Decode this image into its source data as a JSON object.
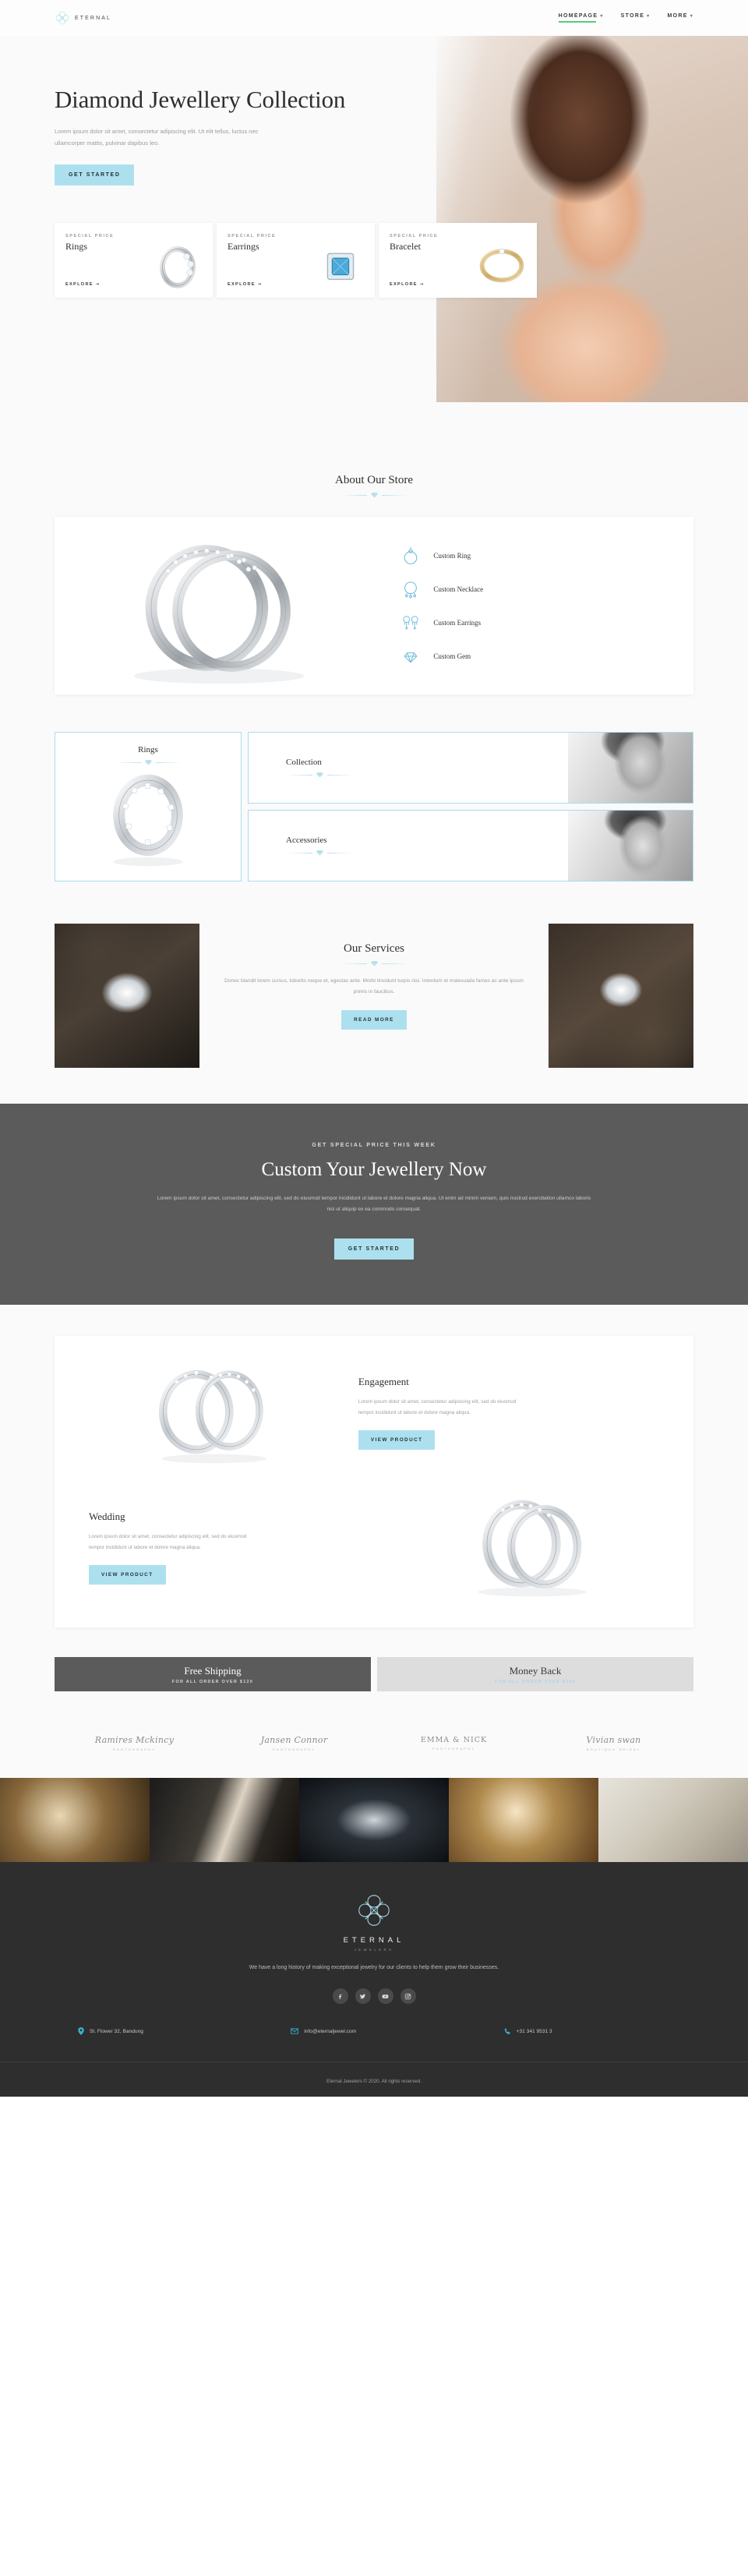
{
  "nav": {
    "brand": "ETERNAL",
    "items": [
      {
        "label": "HOMEPAGE",
        "caret": "▾",
        "active": true
      },
      {
        "label": "STORE",
        "caret": "▾",
        "active": false
      },
      {
        "label": "MORE",
        "caret": "▾",
        "active": false
      }
    ]
  },
  "hero": {
    "title": "Diamond Jewellery Collection",
    "text": "Lorem ipsum dolor sit amet, consectetur adipiscing elit. Ut elit tellus, luctus nec ullamcorper mattis, pulvinar dapibus leo.",
    "cta": "GET STARTED",
    "cards": [
      {
        "label": "SPECIAL PRICE",
        "title": "Rings",
        "link": "EXPLORE ➝",
        "icon": "ring-icon"
      },
      {
        "label": "SPECIAL PRICE",
        "title": "Earrings",
        "link": "EXPLORE ➝",
        "icon": "earring-icon"
      },
      {
        "label": "SPECIAL PRICE",
        "title": "Bracelet",
        "link": "EXPLORE ➝",
        "icon": "bracelet-icon"
      }
    ]
  },
  "about": {
    "title": "About Our Store",
    "features": [
      {
        "label": "Custom Ring",
        "icon": "custom-ring-icon"
      },
      {
        "label": "Custom Necklace",
        "icon": "custom-necklace-icon"
      },
      {
        "label": "Custom Earrings",
        "icon": "custom-earrings-icon"
      },
      {
        "label": "Custom Gem",
        "icon": "custom-gem-icon"
      }
    ]
  },
  "categories": {
    "left": {
      "name": "Rings"
    },
    "rows": [
      {
        "name": "Collection"
      },
      {
        "name": "Accessories"
      }
    ]
  },
  "services": {
    "title": "Our Services",
    "text": "Donec blandit lorem cursus, lobortis neque et, egestas ante. Morbi tincidunt turpis nisi. Interdum et malesuada fames ac ante ipsum primis in faucibus.",
    "cta": "READ MORE"
  },
  "cta": {
    "kicker": "GET SPECIAL PRICE THIS WEEK",
    "title": "Custom Your Jewellery Now",
    "text": "Lorem ipsum dolor sit amet, consectetur adipiscing elit, sed do eiusmod tempor incididunt ut labore et dolore magna aliqua. Ut enim ad minim veniam, quis nostrud exercitation ullamco laboris nisi ut aliquip ex ea commodo consequat.",
    "button": "GET STARTED"
  },
  "products": [
    {
      "title": "Engagement",
      "text": "Lorem ipsum dolor sit amet, consectetur adipiscing elit, sed do eiusmod tempor incididunt ut labore et dolore magna aliqua.",
      "button": "VIEW PRODUCT"
    },
    {
      "title": "Wedding",
      "text": "Lorem ipsum dolor sit amet, consectetur adipiscing elit, sed do eiusmod tempor incididunt ut labore et dolore magna aliqua.",
      "button": "VIEW PRODUCT"
    }
  ],
  "banners": [
    {
      "title": "Free Shipping",
      "sub": "FOR ALL ORDER OVER $120"
    },
    {
      "title": "Money Back",
      "sub": "FOR ALL ORDER OVER $120"
    }
  ],
  "logos": [
    {
      "name": "Ramires Mckincy",
      "sub": "PHOTOGRAPHY"
    },
    {
      "name": "Jansen Connor",
      "sub": "PHOTOGRAPHY"
    },
    {
      "name": "EMMA & NICK",
      "sub": "PHOTOGRAPHY"
    },
    {
      "name": "Vivian swan",
      "sub": "BOUTIQUE BRIDAL"
    }
  ],
  "footer": {
    "brand": "ETERNAL",
    "brand_sub": "JEWELERS",
    "desc": "We have a long history of making exceptional jewelry for our clients to help them grow their businesses.",
    "social": [
      {
        "name": "facebook-icon",
        "glyph": "f"
      },
      {
        "name": "twitter-icon",
        "glyph": "t"
      },
      {
        "name": "youtube-icon",
        "glyph": "▶"
      },
      {
        "name": "instagram-icon",
        "glyph": "◎"
      }
    ],
    "contact": [
      {
        "icon": "location-pin-icon",
        "text": "St. Flower 32, Bandung"
      },
      {
        "icon": "envelope-icon",
        "text": "info@eternaljewel.com"
      },
      {
        "icon": "phone-icon",
        "text": "+31 341 9531 3"
      }
    ],
    "copyright": "Eternal Jewelers © 2020. All rights reserved."
  },
  "colors": {
    "accent": "#ade0ef",
    "nav_active": "#5bc97a",
    "dark": "#5b5b5b",
    "footer": "#2e2e2e"
  }
}
